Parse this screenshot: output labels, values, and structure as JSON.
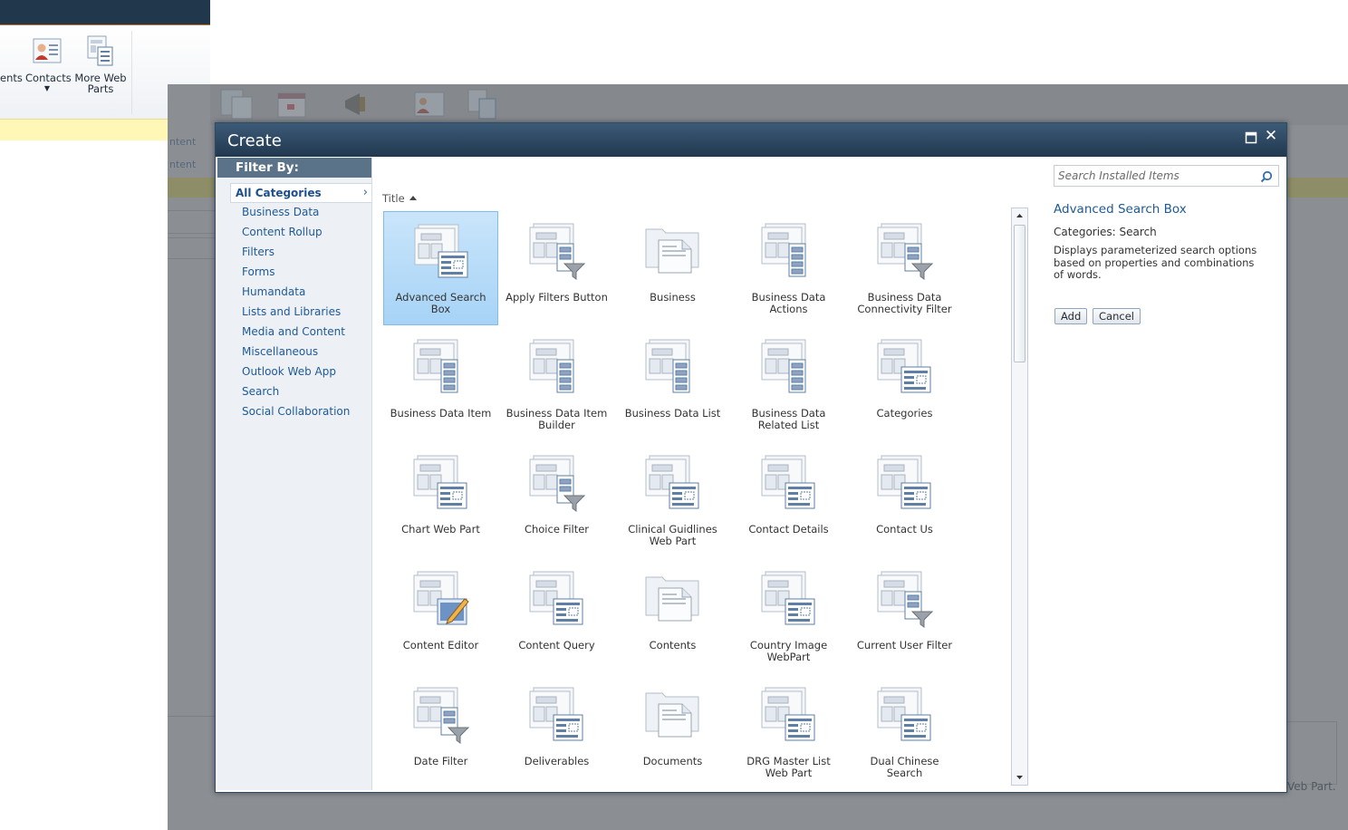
{
  "background": {
    "ribbon": {
      "partial_label": "ents",
      "contacts_label": "Contacts",
      "more_web_parts_label": "More Web\nParts"
    },
    "overlay_texts": {
      "content_dropdown": "ntent",
      "content_link": "ntent",
      "web_part_text": "Veb Part."
    }
  },
  "dialog": {
    "title": "Create",
    "maximize_icon": "maximize-icon",
    "close_icon": "close-icon"
  },
  "filter": {
    "header": "Filter By:",
    "items": [
      {
        "label": "All Categories",
        "selected": true
      },
      {
        "label": "Business Data"
      },
      {
        "label": "Content Rollup"
      },
      {
        "label": "Filters"
      },
      {
        "label": "Forms"
      },
      {
        "label": "Humandata"
      },
      {
        "label": "Lists and Libraries"
      },
      {
        "label": "Media and Content"
      },
      {
        "label": "Miscellaneous"
      },
      {
        "label": "Outlook Web App"
      },
      {
        "label": "Search"
      },
      {
        "label": "Social Collaboration"
      }
    ]
  },
  "grid": {
    "sort_label": "Title",
    "tiles": [
      {
        "label": "Advanced Search\nBox",
        "icon": "webpart-form-icon",
        "selected": true
      },
      {
        "label": "Apply Filters Button",
        "icon": "webpart-filter-icon"
      },
      {
        "label": "Business",
        "icon": "folder-document-icon"
      },
      {
        "label": "Business Data\nActions",
        "icon": "webpart-list-icon"
      },
      {
        "label": "Business Data\nConnectivity Filter",
        "icon": "webpart-filter-icon"
      },
      {
        "label": "Business Data Item",
        "icon": "webpart-list-icon"
      },
      {
        "label": "Business Data Item\nBuilder",
        "icon": "webpart-list-icon"
      },
      {
        "label": "Business Data List",
        "icon": "webpart-list-icon"
      },
      {
        "label": "Business Data\nRelated List",
        "icon": "webpart-list-icon"
      },
      {
        "label": "Categories",
        "icon": "webpart-form-icon"
      },
      {
        "label": "Chart Web Part",
        "icon": "webpart-form-icon"
      },
      {
        "label": "Choice Filter",
        "icon": "webpart-filter-icon"
      },
      {
        "label": "Clinical Guidlines\nWeb Part",
        "icon": "webpart-form-icon"
      },
      {
        "label": "Contact Details",
        "icon": "webpart-form-icon"
      },
      {
        "label": "Contact Us",
        "icon": "webpart-form-icon"
      },
      {
        "label": "Content Editor",
        "icon": "webpart-edit-icon"
      },
      {
        "label": "Content Query",
        "icon": "webpart-form-icon"
      },
      {
        "label": "Contents",
        "icon": "folder-document-icon"
      },
      {
        "label": "Country Image\nWebPart",
        "icon": "webpart-form-icon"
      },
      {
        "label": "Current User Filter",
        "icon": "webpart-filter-icon"
      },
      {
        "label": "Date Filter",
        "icon": "webpart-filter-icon"
      },
      {
        "label": "Deliverables",
        "icon": "webpart-form-icon"
      },
      {
        "label": "Documents",
        "icon": "folder-document-icon"
      },
      {
        "label": "DRG Master List\nWeb Part",
        "icon": "webpart-form-icon"
      },
      {
        "label": "Dual Chinese\nSearch",
        "icon": "webpart-form-icon"
      }
    ]
  },
  "details": {
    "search_placeholder": "Search Installed Items",
    "title": "Advanced Search Box",
    "categories": "Categories: Search",
    "description": "Displays parameterized search options based on properties and combinations of words.",
    "add_label": "Add",
    "cancel_label": "Cancel"
  },
  "colors": {
    "titlebar": "#21384f",
    "link": "#1e5a96",
    "selected_tile": "#a7d3f6",
    "overlay": "#8b8f93"
  }
}
